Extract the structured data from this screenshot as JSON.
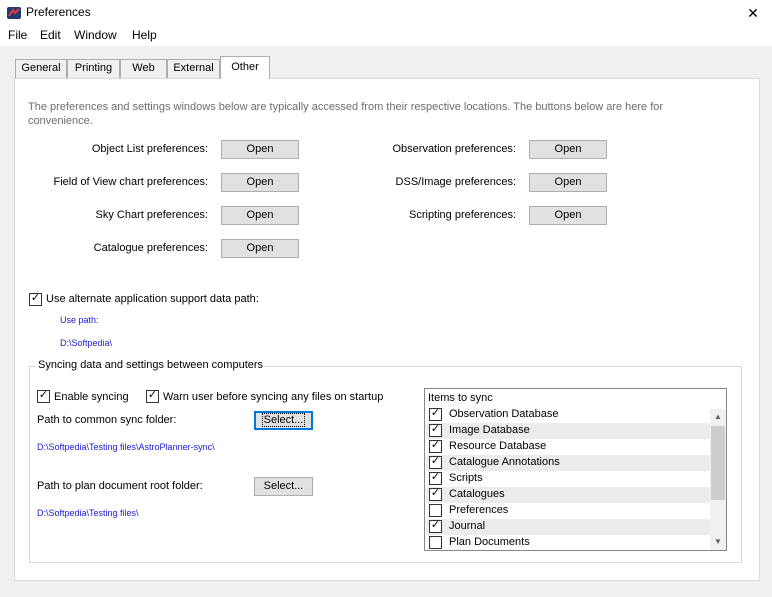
{
  "window": {
    "title": "Preferences",
    "close_glyph": "✕"
  },
  "menu": [
    "File",
    "Edit",
    "Window",
    "Help"
  ],
  "tabs": [
    {
      "label": "General",
      "active": false
    },
    {
      "label": "Printing",
      "active": false
    },
    {
      "label": "Web",
      "active": false
    },
    {
      "label": "External",
      "active": false
    },
    {
      "label": "Other",
      "active": true
    }
  ],
  "description": "The preferences and settings windows below are typically accessed from their respective locations. The buttons below are here for convenience.",
  "prefs_left": [
    {
      "label": "Object List preferences:",
      "button": "Open"
    },
    {
      "label": "Field of View chart preferences:",
      "button": "Open"
    },
    {
      "label": "Sky Chart preferences:",
      "button": "Open"
    },
    {
      "label": "Catalogue preferences:",
      "button": "Open"
    }
  ],
  "prefs_right": [
    {
      "label": "Observation preferences:",
      "button": "Open"
    },
    {
      "label": "DSS/Image preferences:",
      "button": "Open"
    },
    {
      "label": "Scripting preferences:",
      "button": "Open"
    }
  ],
  "alt_path": {
    "checked": true,
    "label": "Use alternate application support data path:",
    "use_path_label": "Use path:",
    "path": "D:\\Softpedia\\"
  },
  "sync": {
    "group_title": "Syncing data and settings between computers",
    "enable_syncing": {
      "checked": true,
      "label": "Enable syncing"
    },
    "warn_user": {
      "checked": true,
      "label": "Warn user before syncing any files on startup"
    },
    "common_folder_label": "Path to common sync folder:",
    "common_folder_button": "Select...",
    "common_folder_path": "D:\\Softpedia\\Testing files\\AstroPlanner-sync\\",
    "plan_root_label": "Path to plan document root folder:",
    "plan_root_button": "Select...",
    "plan_root_path": "D:\\Softpedia\\Testing files\\",
    "items_header": "Items to sync",
    "items": [
      {
        "label": "Observation Database",
        "checked": true
      },
      {
        "label": "Image Database",
        "checked": true
      },
      {
        "label": "Resource Database",
        "checked": true
      },
      {
        "label": "Catalogue Annotations",
        "checked": true
      },
      {
        "label": "Scripts",
        "checked": true
      },
      {
        "label": "Catalogues",
        "checked": true
      },
      {
        "label": "Preferences",
        "checked": false
      },
      {
        "label": "Journal",
        "checked": true
      },
      {
        "label": "Plan Documents",
        "checked": false
      }
    ]
  },
  "check_glyph": "✓",
  "colors": {
    "link_blue": "#1a1ad3",
    "focus_blue": "#0078d7"
  }
}
